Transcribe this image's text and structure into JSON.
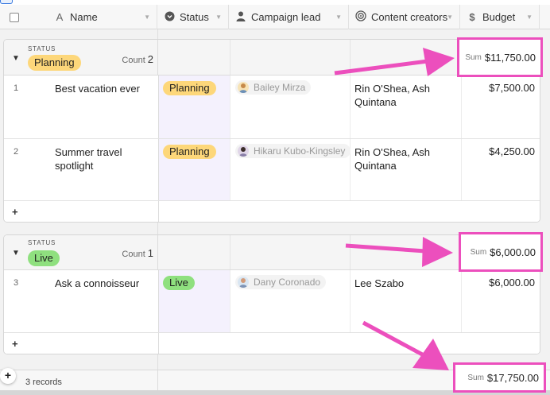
{
  "columns": [
    {
      "label": "Name",
      "icon": "text-icon",
      "glyph": "A"
    },
    {
      "label": "Status",
      "icon": "status-icon",
      "glyph": "▾"
    },
    {
      "label": "Campaign lead",
      "icon": "person-icon",
      "glyph": "●"
    },
    {
      "label": "Content creators",
      "icon": "collaborator-icon",
      "glyph": "◎"
    },
    {
      "label": "Budget",
      "icon": "currency-icon",
      "glyph": "$"
    }
  ],
  "groups": [
    {
      "field_label": "STATUS",
      "value": "Planning",
      "count_label": "Count",
      "count": "2",
      "sum_label": "Sum",
      "sum": "$11,750.00",
      "rows": [
        {
          "num": "1",
          "name": "Best vacation ever",
          "status": "Planning",
          "lead": "Bailey Mirza",
          "creators": "Rin O'Shea, Ash Quintana",
          "budget": "$7,500.00"
        },
        {
          "num": "2",
          "name": "Summer travel spotlight",
          "status": "Planning",
          "lead": "Hikaru Kubo-Kingsley",
          "creators": "Rin O'Shea, Ash Quintana",
          "budget": "$4,250.00"
        }
      ]
    },
    {
      "field_label": "STATUS",
      "value": "Live",
      "count_label": "Count",
      "count": "1",
      "sum_label": "Sum",
      "sum": "$6,000.00",
      "rows": [
        {
          "num": "3",
          "name": "Ask a connoisseur",
          "status": "Live",
          "lead": "Dany Coronado",
          "creators": "Lee Szabo",
          "budget": "$6,000.00"
        }
      ]
    }
  ],
  "add_row_glyph": "+",
  "footer": {
    "add_glyph": "+",
    "records": "3 records",
    "sum_label": "Sum",
    "sum": "$17,750.00"
  },
  "colors": {
    "planning": "#fdd77a",
    "live": "#8fe07f",
    "highlight": "#ec4fbd"
  }
}
